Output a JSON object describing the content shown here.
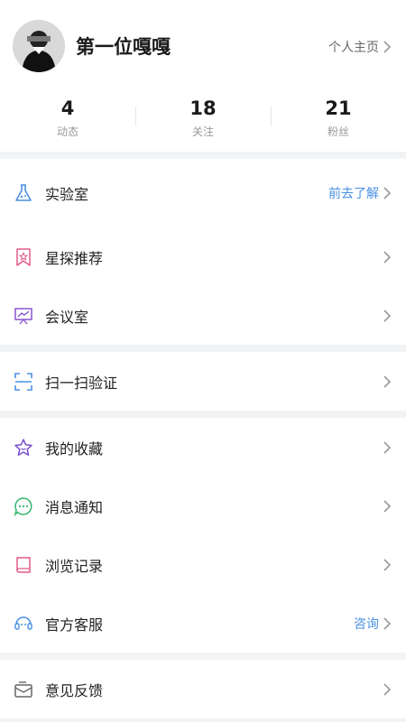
{
  "profile": {
    "username": "第一位嘎嘎",
    "home_link": "个人主页"
  },
  "stats": [
    {
      "value": "4",
      "label": "动态"
    },
    {
      "value": "18",
      "label": "关注"
    },
    {
      "value": "21",
      "label": "粉丝"
    }
  ],
  "menu": {
    "lab": {
      "label": "实验室",
      "extra": "前去了解"
    },
    "star": {
      "label": "星探推荐"
    },
    "meeting": {
      "label": "会议室"
    },
    "scan": {
      "label": "扫一扫验证"
    },
    "favorites": {
      "label": "我的收藏"
    },
    "messages": {
      "label": "消息通知"
    },
    "history": {
      "label": "浏览记录"
    },
    "service": {
      "label": "官方客服",
      "extra": "咨询"
    },
    "feedback": {
      "label": "意见反馈"
    }
  },
  "colors": {
    "accent": "#4a90e2",
    "lab_icon": "#4a90e2",
    "star_icon": "#e35a8a",
    "meeting_icon": "#8a55d0",
    "scan_icon": "#4a90e2",
    "favorites_icon": "#7a4fd0",
    "messages_icon": "#2fb66b",
    "history_icon": "#e35a8a",
    "service_icon": "#4a90e2",
    "feedback_icon": "#666666"
  }
}
